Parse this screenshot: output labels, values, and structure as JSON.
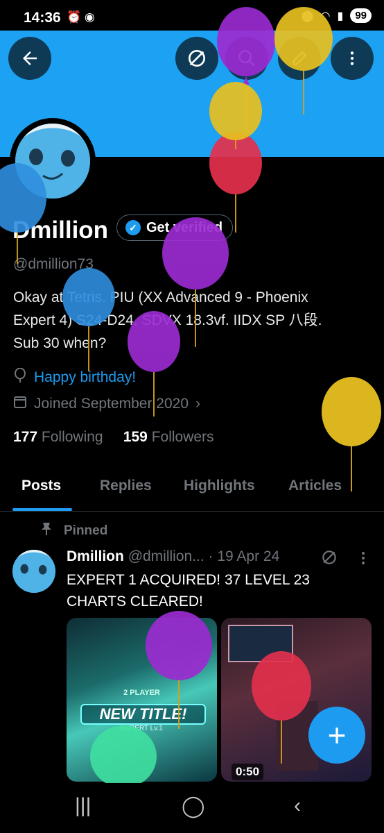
{
  "status_bar": {
    "time": "14:36",
    "battery": "99"
  },
  "profile": {
    "name": "Dmillion",
    "get_verified_label": "Get verified",
    "handle": "@dmillion73",
    "bio_line1": "Okay at Tetris. PIU (XX Advanced 9 - Phoenix",
    "bio_line2": "Expert 4) S24-D24. SDVX 18.3vf. IIDX SP 八段.",
    "bio_line3": "Sub 30 when?",
    "birthday_text": "Happy birthday!",
    "joined_text": "Joined September 2020",
    "following_count": "177",
    "following_label": "Following",
    "followers_count": "159",
    "followers_label": "Followers"
  },
  "tabs": [
    {
      "label": "Posts"
    },
    {
      "label": "Replies"
    },
    {
      "label": "Highlights"
    },
    {
      "label": "Articles"
    }
  ],
  "pinned_post": {
    "pinned_label": "Pinned",
    "author": "Dmillion",
    "handle": "@dmillion...",
    "date": "· 19 Apr 24",
    "text_line1": "EXPERT 1 ACQUIRED! 37 LEVEL 23",
    "text_line2": "CHARTS CLEARED!",
    "video_duration": "0:50",
    "media1_caption1": "2 PLAYER",
    "media1_caption2": "NEW TITLE!",
    "media1_caption3": "EXPERT Lv.1"
  },
  "colors": {
    "banner": "#1da1f2",
    "accent": "#1d9bf0",
    "background": "#000000"
  },
  "icons": [
    "back-arrow-icon",
    "grok-icon",
    "search-icon",
    "edit-icon",
    "more-vertical-icon",
    "location-icon",
    "calendar-icon",
    "pin-icon",
    "plus-icon"
  ]
}
